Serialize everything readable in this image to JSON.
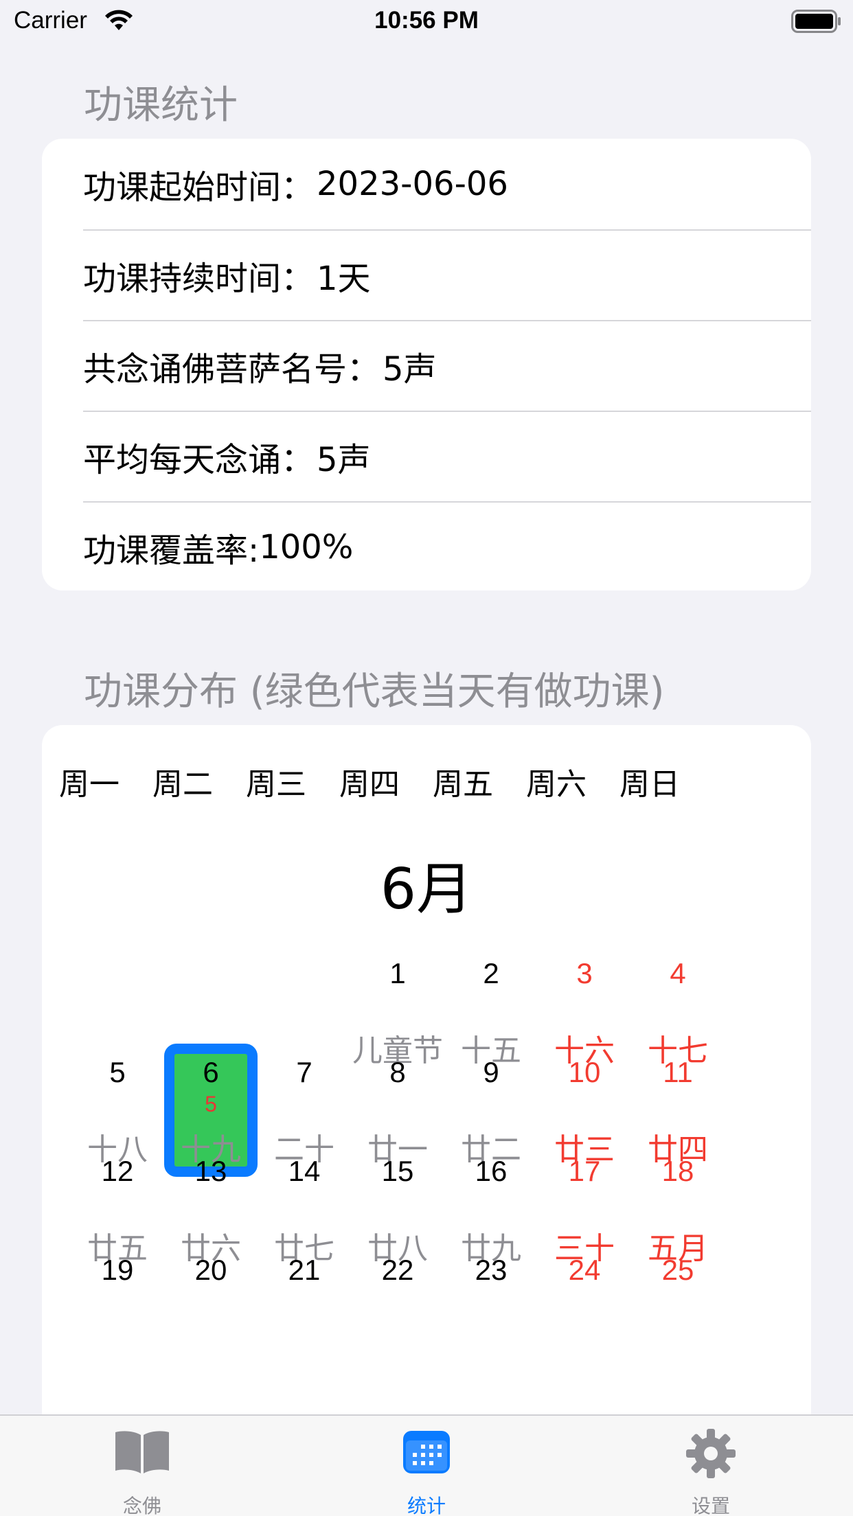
{
  "status_bar": {
    "carrier": "Carrier",
    "time": "10:56 PM"
  },
  "stats_section": {
    "header": "功课统计",
    "rows": [
      {
        "label": "功课起始时间：",
        "value": "2023-06-06"
      },
      {
        "label": "功课持续时间：",
        "value": "1天"
      },
      {
        "label": "共念诵佛菩萨名号：",
        "value": "5声"
      },
      {
        "label": "平均每天念诵：",
        "value": "5声"
      },
      {
        "label": "功课覆盖率:",
        "value": "100%"
      }
    ]
  },
  "distribution_section": {
    "header": "功课分布 (绿色代表当天有做功课)",
    "weekdays": [
      "周一",
      "周二",
      "周三",
      "周四",
      "周五",
      "周六",
      "周日"
    ],
    "month_title": "6月",
    "weeks": [
      [
        null,
        null,
        null,
        {
          "day": "1",
          "lunar": "儿童节"
        },
        {
          "day": "2",
          "lunar": "十五"
        },
        {
          "day": "3",
          "lunar": "十六"
        },
        {
          "day": "4",
          "lunar": "十七"
        }
      ],
      [
        {
          "day": "5",
          "lunar": "十八"
        },
        {
          "day": "6",
          "lunar": "十九",
          "count": "5",
          "done": true
        },
        {
          "day": "7",
          "lunar": "二十"
        },
        {
          "day": "8",
          "lunar": "廿一"
        },
        {
          "day": "9",
          "lunar": "廿二"
        },
        {
          "day": "10",
          "lunar": "廿三"
        },
        {
          "day": "11",
          "lunar": "廿四"
        }
      ],
      [
        {
          "day": "12",
          "lunar": "廿五"
        },
        {
          "day": "13",
          "lunar": "廿六"
        },
        {
          "day": "14",
          "lunar": "廿七"
        },
        {
          "day": "15",
          "lunar": "廿八"
        },
        {
          "day": "16",
          "lunar": "廿九"
        },
        {
          "day": "17",
          "lunar": "三十"
        },
        {
          "day": "18",
          "lunar": "五月"
        }
      ],
      [
        {
          "day": "19",
          "lunar": ""
        },
        {
          "day": "20",
          "lunar": ""
        },
        {
          "day": "21",
          "lunar": ""
        },
        {
          "day": "22",
          "lunar": ""
        },
        {
          "day": "23",
          "lunar": ""
        },
        {
          "day": "24",
          "lunar": ""
        },
        {
          "day": "25",
          "lunar": ""
        }
      ]
    ]
  },
  "tab_bar": {
    "tabs": [
      {
        "label": "念佛",
        "icon": "book-icon",
        "active": false
      },
      {
        "label": "统计",
        "icon": "calendar-icon",
        "active": true
      },
      {
        "label": "设置",
        "icon": "gear-icon",
        "active": false
      }
    ]
  },
  "colors": {
    "accent": "#0a7bff",
    "done_green": "#35c759",
    "weekend_red": "#f23b30",
    "secondary_text": "#8e8e93"
  }
}
